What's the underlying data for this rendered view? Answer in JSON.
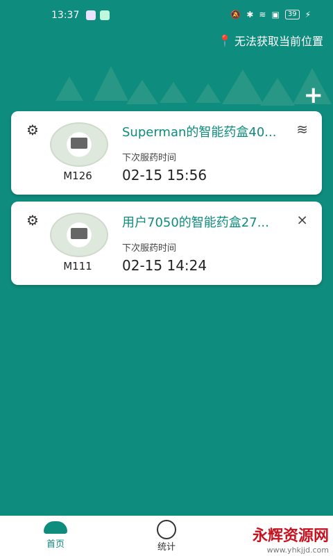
{
  "status": {
    "time": "13:37",
    "battery": "39"
  },
  "location_text": "无法获取当前位置",
  "devices": [
    {
      "model": "M126",
      "name": "Superman的智能药盒40...",
      "next_label": "下次服药时间",
      "next_time": "02-15 15:56",
      "connection_icon": "wifi-icon"
    },
    {
      "model": "M111",
      "name": "用户7050的智能药盒27...",
      "next_label": "下次服药时间",
      "next_time": "02-15 14:24",
      "connection_icon": "bluetooth-off-icon"
    }
  ],
  "nav": {
    "home": "首页",
    "stats": "统计"
  },
  "watermark": {
    "brand": "永辉资源网",
    "url": "www.yhkjjd.com"
  },
  "colors": {
    "primary": "#0e8c7d"
  }
}
